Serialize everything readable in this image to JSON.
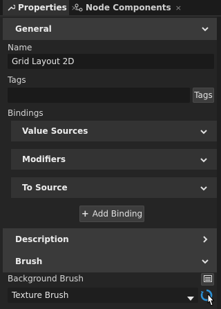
{
  "tabs": [
    {
      "label": "Properties",
      "icon": "wrench-icon",
      "close": "×"
    },
    {
      "label": "Node Components",
      "icon": "node-components-icon",
      "close": "×"
    }
  ],
  "sections": {
    "general": "General",
    "description": "Description",
    "brush": "Brush"
  },
  "fields": {
    "name_label": "Name",
    "name_value": "Grid Layout 2D",
    "tags_label": "Tags",
    "tags_value": "",
    "tags_button": "Tags",
    "bindings_label": "Bindings",
    "background_brush_label": "Background Brush",
    "background_brush_value": "Texture Brush"
  },
  "bindings": {
    "value_sources": "Value Sources",
    "modifiers": "Modifiers",
    "to_source": "To Source",
    "add_binding": "Add Binding",
    "add_icon": "+"
  },
  "colors": {
    "panel_bg": "#252525",
    "section_bg": "#3a3a3a",
    "field_bg": "#1a1a1a",
    "accent": "#2a8fd4"
  }
}
